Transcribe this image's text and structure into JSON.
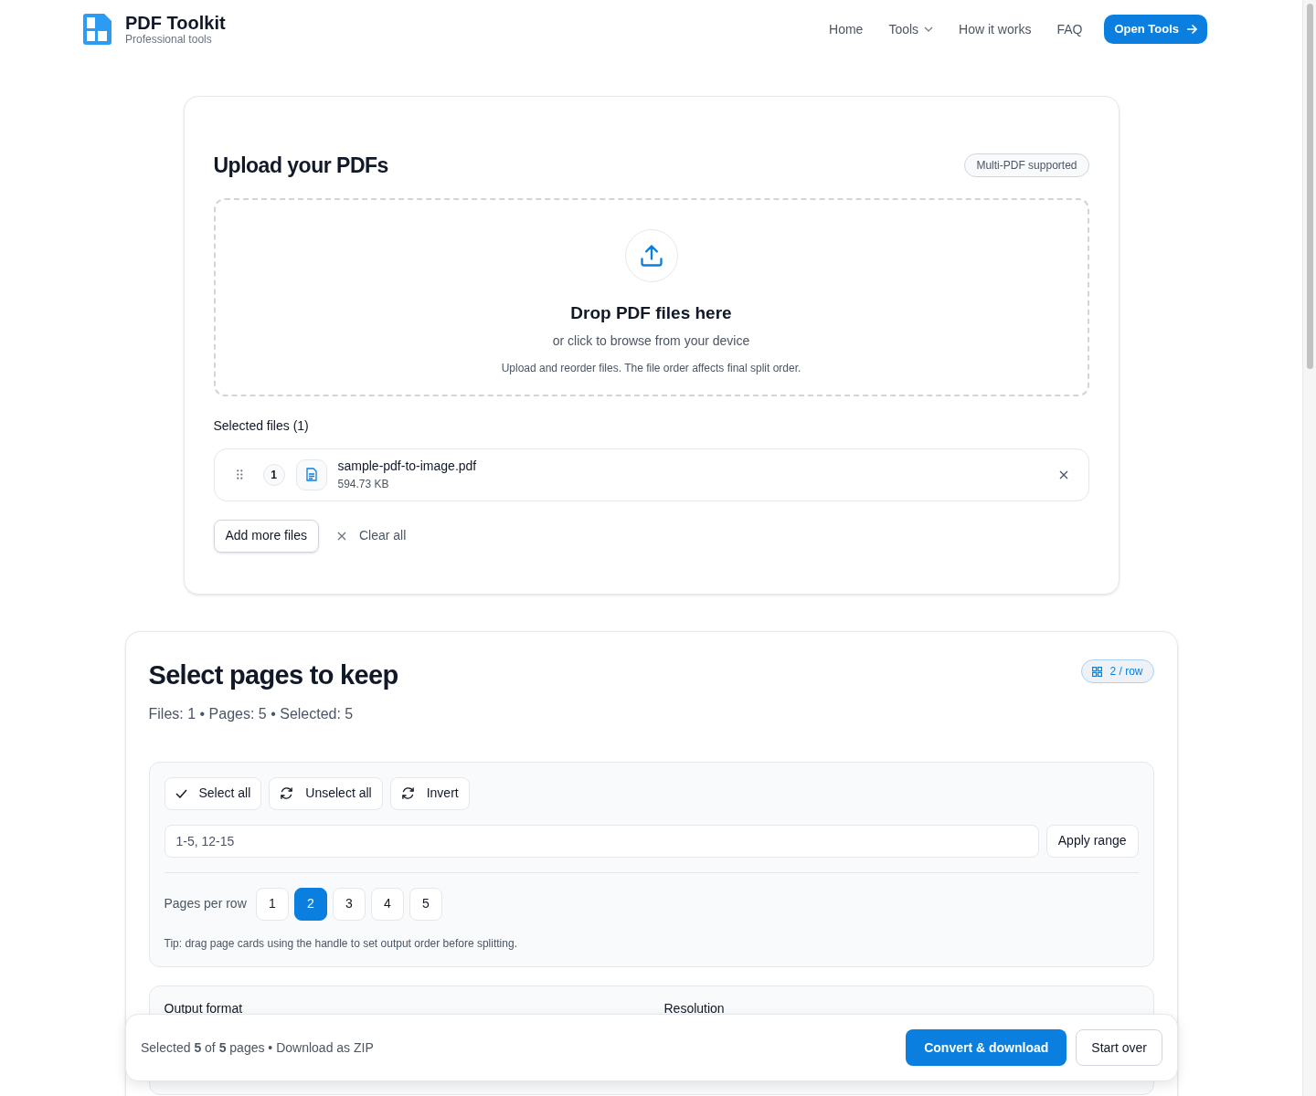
{
  "brand": {
    "name": "PDF Toolkit",
    "tagline": "Professional tools"
  },
  "nav": [
    {
      "label": "Home",
      "kind": "link"
    },
    {
      "label": "Tools",
      "kind": "dropdown"
    },
    {
      "label": "How it works",
      "kind": "link"
    },
    {
      "label": "FAQ",
      "kind": "link"
    }
  ],
  "nav_button": "Open Tools",
  "upload": {
    "title": "Upload your PDFs",
    "badge": "Multi-PDF supported",
    "drop_title": "Drop PDF files here",
    "drop_subtitle": "or click to browse from your device",
    "drop_note": "Upload and reorder files. The file order affects final split order.",
    "files_heading": "Selected files (1)",
    "files": [
      {
        "index": "1",
        "name": "sample-pdf-to-image.pdf",
        "size": "594.73 KB"
      }
    ],
    "add_button": "Add more files",
    "clear_button": "Clear all"
  },
  "pages": {
    "title": "Select pages to keep",
    "summary": "Files: 1 • Pages: 5 • Selected: 5",
    "badge": "2 / row",
    "actions": [
      {
        "label": "Select all",
        "kind": "check"
      },
      {
        "label": "Unselect all",
        "kind": "refresh"
      },
      {
        "label": "Invert",
        "kind": "refresh"
      }
    ],
    "range_placeholder": "1-5, 12-15",
    "apply_button": "Apply range",
    "per_row_label": "Pages per row",
    "per_row": [
      {
        "label": "1",
        "selected": false
      },
      {
        "label": "2",
        "selected": true
      },
      {
        "label": "3",
        "selected": false
      },
      {
        "label": "4",
        "selected": false
      },
      {
        "label": "5",
        "selected": false
      }
    ],
    "tip": "Tip: drag page cards using the handle to set output order before splitting.",
    "output_format_label": "Output format",
    "resolution_label": "Resolution"
  },
  "footer_bar": {
    "summary": "Selected **5** of **5** pages • Download as ZIP",
    "primary": "Convert & download",
    "secondary": "Start over"
  }
}
